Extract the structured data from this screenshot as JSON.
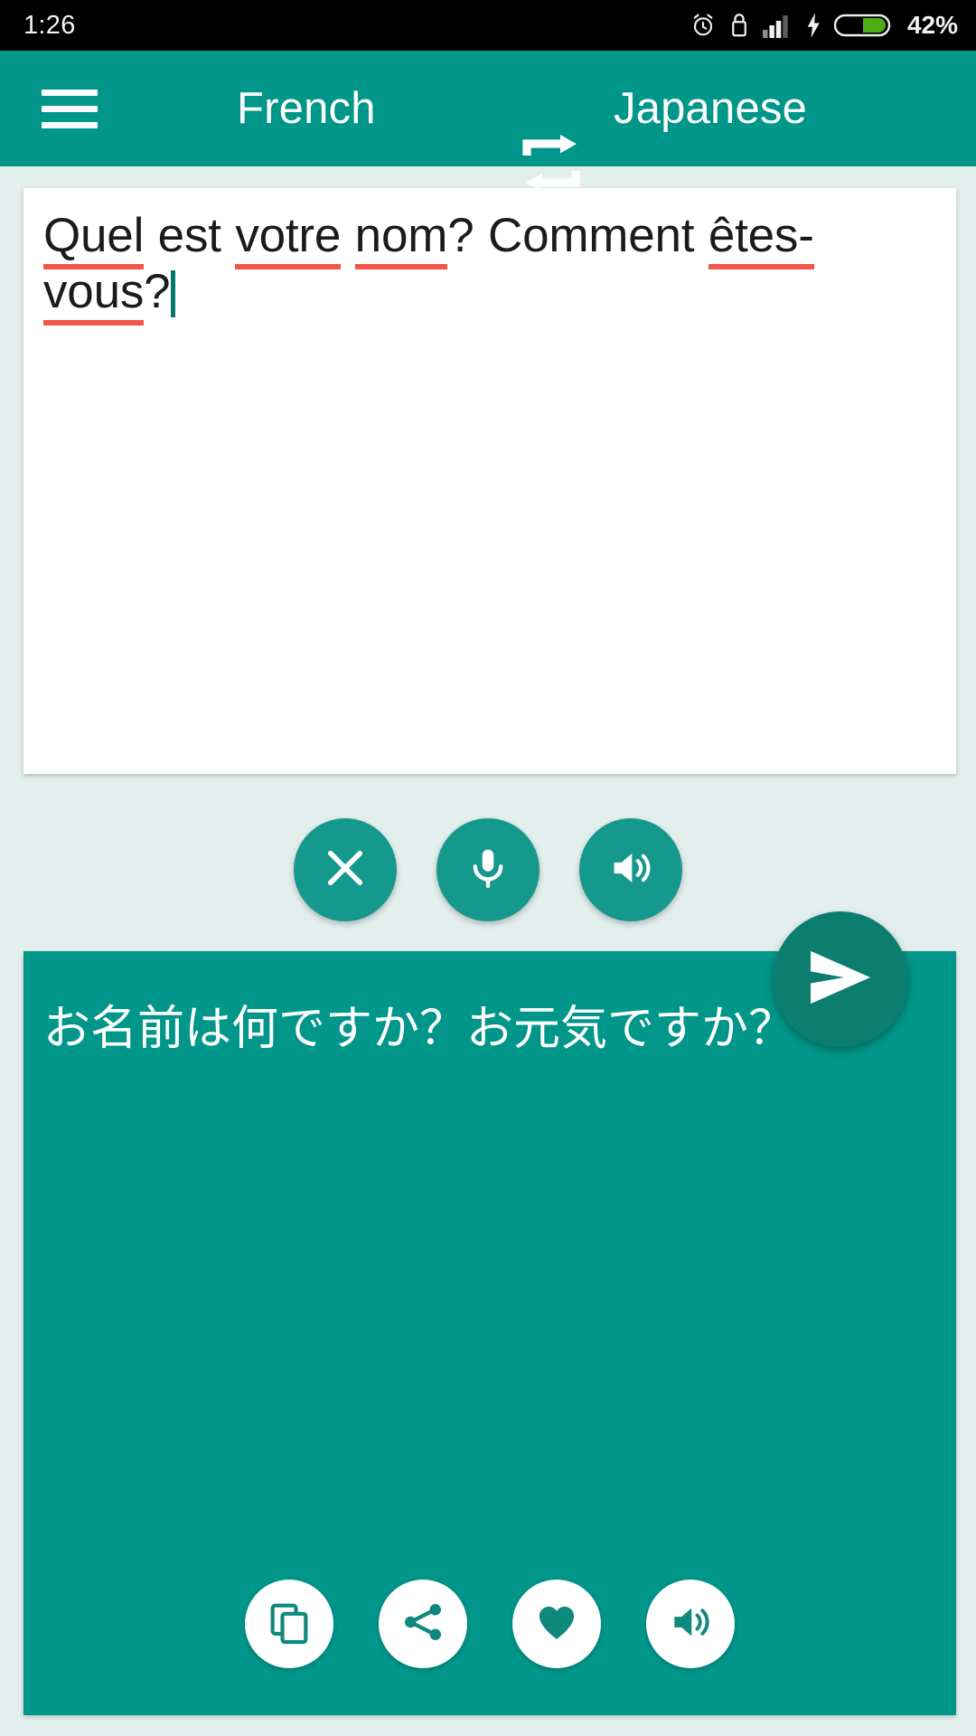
{
  "status_bar": {
    "time": "1:26",
    "battery_percent": "42%",
    "icons": [
      "alarm-icon",
      "lock-icon",
      "signal-icon",
      "charging-bolt-icon",
      "battery-icon"
    ]
  },
  "app_bar": {
    "menu_icon": "hamburger-menu-icon",
    "source_language": "French",
    "swap_icon": "swap-languages-icon",
    "target_language": "Japanese"
  },
  "source_panel": {
    "text_full": "Quel est votre nom? Comment êtes-vous?",
    "segments": [
      {
        "text": "Quel",
        "misspelled": true
      },
      {
        "text": " est ",
        "misspelled": false
      },
      {
        "text": "votre",
        "misspelled": true
      },
      {
        "text": " ",
        "misspelled": false
      },
      {
        "text": "nom",
        "misspelled": true
      },
      {
        "text": "? Comment ",
        "misspelled": false
      },
      {
        "text": "êtes-vous",
        "misspelled": true
      },
      {
        "text": "?",
        "misspelled": false
      }
    ],
    "caret_visible": true,
    "actions": [
      {
        "name": "clear-button",
        "icon": "close-icon",
        "label": "Clear"
      },
      {
        "name": "mic-button",
        "icon": "microphone-icon",
        "label": "Voice input"
      },
      {
        "name": "speak-source-button",
        "icon": "speaker-icon",
        "label": "Listen"
      }
    ],
    "send": {
      "name": "translate-button",
      "icon": "send-icon",
      "label": "Translate"
    }
  },
  "target_panel": {
    "text": "お名前は何ですか？お元気ですか？",
    "actions": [
      {
        "name": "copy-button",
        "icon": "copy-icon",
        "label": "Copy"
      },
      {
        "name": "share-button",
        "icon": "share-icon",
        "label": "Share"
      },
      {
        "name": "favorite-button",
        "icon": "heart-icon",
        "label": "Favorite"
      },
      {
        "name": "speak-target-button",
        "icon": "speaker-icon",
        "label": "Listen"
      }
    ]
  },
  "colors": {
    "primary": "#00968a",
    "primary_dark": "#0c7e70",
    "fab": "#15998c",
    "background": "#e2efed",
    "spellcheck_underline": "#f4554a",
    "battery_green": "#4caf16"
  }
}
